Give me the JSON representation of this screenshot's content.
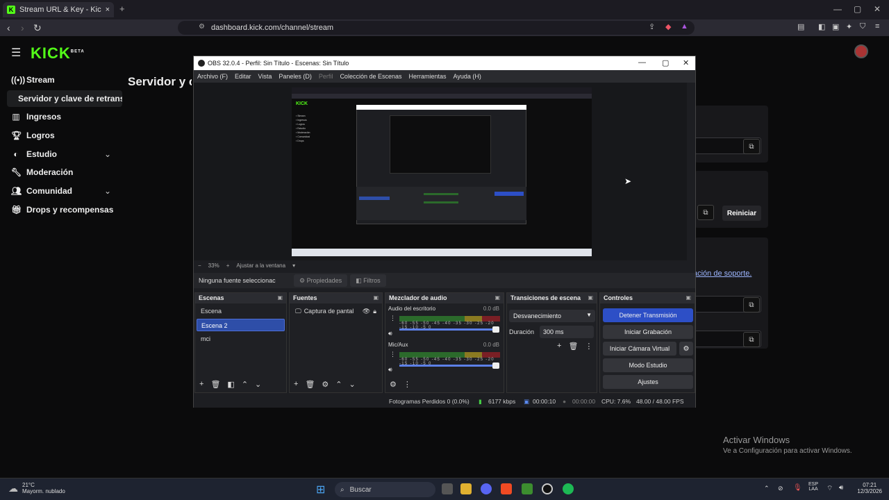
{
  "browser": {
    "tab_title": "Stream URL & Key - Kick Dashbo",
    "url": "dashboard.kick.com/channel/stream"
  },
  "kick": {
    "logo": "KICK",
    "logo_badge": "BETA",
    "nav": [
      {
        "label": "Stream",
        "icon": "broadcast-icon"
      },
      {
        "label": "Servidor y clave de retransm",
        "icon": ""
      },
      {
        "label": "Ingresos",
        "icon": "chart-icon"
      },
      {
        "label": "Logros",
        "icon": "trophy-icon"
      },
      {
        "label": "Estudio",
        "icon": "palette-icon"
      },
      {
        "label": "Moderación",
        "icon": "wrench-icon"
      },
      {
        "label": "Comunidad",
        "icon": "people-icon"
      },
      {
        "label": "Drops y recompensas",
        "icon": "gift-icon"
      }
    ],
    "page_title": "Servidor y c",
    "reiniciar": "Reiniciar",
    "support_link": "ación de soporte."
  },
  "watermark": {
    "line1": "Activar Windows",
    "line2": "Ve a Configuración para activar Windows."
  },
  "obs": {
    "title": "OBS 32.0.4 - Perfil: Sin Título - Escenas: Sin Título",
    "menu": [
      {
        "label": "Archivo (F)",
        "enabled": true
      },
      {
        "label": "Editar",
        "enabled": true
      },
      {
        "label": "Vista",
        "enabled": true
      },
      {
        "label": "Paneles (D)",
        "enabled": true
      },
      {
        "label": "Perfil",
        "enabled": false
      },
      {
        "label": "Colección de Escenas",
        "enabled": true
      },
      {
        "label": "Herramientas",
        "enabled": true
      },
      {
        "label": "Ayuda (H)",
        "enabled": true
      }
    ],
    "zoom": "33%",
    "fit": "Ajustar a la ventana",
    "no_source": "Ninguna fuente seleccionac",
    "properties": "Propiedades",
    "filters": "Filtros",
    "scenes_title": "Escenas",
    "scenes": [
      "Escena",
      "Escena 2",
      "mci"
    ],
    "sources_title": "Fuentes",
    "source": "Captura de pantal",
    "mixer_title": "Mezclador de audio",
    "mixer": [
      {
        "name": "Audio del escritorio",
        "db": "0.0 dB"
      },
      {
        "name": "Mic/Aux",
        "db": "0.0 dB"
      }
    ],
    "scale": "-60 -55 -50 -45 -40 -35 -30 -25 -20 -15 -10 -5 0",
    "transitions_title": "Transiciones de escena",
    "transition": "Desvanecimiento",
    "duration_label": "Duración",
    "duration": "300 ms",
    "controls_title": "Controles",
    "controls": [
      "Detener Transmisión",
      "Iniciar Grabación",
      "Iniciar Cámara Virtual",
      "Modo Estudio",
      "Ajustes"
    ],
    "status": {
      "frames": "Fotogramas Perdidos 0 (0.0%)",
      "bitrate": "6177 kbps",
      "stream_time": "00:00:10",
      "rec_time": "00:00:00",
      "cpu": "CPU: 7.6%",
      "fps": "48.00 / 48.00 FPS"
    }
  },
  "taskbar": {
    "temp": "21°C",
    "weather": "Mayorm. nublado",
    "search": "Buscar",
    "lang1": "ESP",
    "lang2": "LAA",
    "time": "07:21",
    "date": "12/3/2026"
  }
}
